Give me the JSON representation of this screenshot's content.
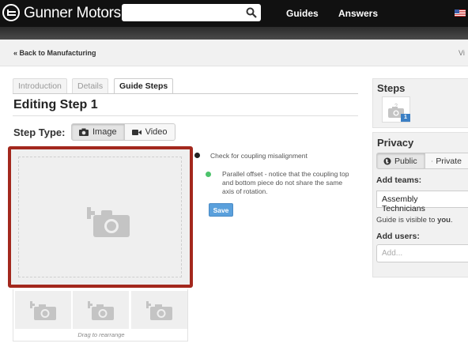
{
  "header": {
    "brand": "Gunner Motors",
    "search": {
      "value": ""
    },
    "nav": {
      "guides": "Guides",
      "answers": "Answers"
    }
  },
  "subnav": {
    "back_link": "« Back to Manufacturing",
    "right_link": "Vi"
  },
  "tabs": [
    {
      "label": "Introduction",
      "active": false
    },
    {
      "label": "Details",
      "active": false
    },
    {
      "label": "Guide Steps",
      "active": true
    }
  ],
  "editor": {
    "heading": "Editing Step 1",
    "step_type_label": "Step Type:",
    "step_types": [
      {
        "label": "Image",
        "icon": "camera-icon",
        "selected": true
      },
      {
        "label": "Video",
        "icon": "video-icon",
        "selected": false
      }
    ],
    "drag_hint": "Drag to rearrange",
    "bullets": [
      {
        "color": "#222222",
        "text": "Check for coupling misalignment"
      },
      {
        "color": "#4cc36b",
        "text": "Parallel offset - notice that the coupling top and bottom piece do not share the same axis of rotation."
      }
    ],
    "save_label": "Save"
  },
  "sidebar": {
    "steps_title": "Steps",
    "step_badge": "1",
    "privacy_title": "Privacy",
    "privacy_options": [
      {
        "label": "Public",
        "icon": "globe-icon",
        "selected": true
      },
      {
        "label": "Private",
        "icon": "edit-icon",
        "selected": false
      }
    ],
    "add_teams_label": "Add teams:",
    "team_value": "Assembly Technicians",
    "visible_prefix": "Guide is visible to ",
    "visible_emphasis": "you",
    "visible_suffix": ".",
    "add_users_label": "Add users:",
    "add_users_placeholder": "Add..."
  },
  "colors": {
    "accent_border": "#a3281d",
    "save_button": "#5aa0dc",
    "badge": "#3b7fc4"
  }
}
